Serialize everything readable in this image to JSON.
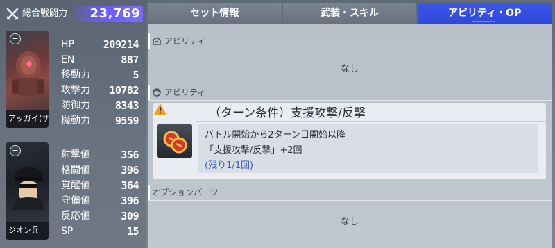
{
  "combat_power": {
    "label": "総合戦闘力",
    "value": "23,769",
    "icon": "crossed-swords-icon"
  },
  "mobile_suit": {
    "name": "アッガイ(サン",
    "stats": [
      {
        "label": "HP",
        "value": "209214"
      },
      {
        "label": "EN",
        "value": "887"
      },
      {
        "label": "移動力",
        "value": "5"
      },
      {
        "label": "攻撃力",
        "value": "10782"
      },
      {
        "label": "防御力",
        "value": "8343"
      },
      {
        "label": "機動力",
        "value": "9559"
      }
    ]
  },
  "pilot": {
    "name": "ジオン兵",
    "stats": [
      {
        "label": "射撃値",
        "value": "356"
      },
      {
        "label": "格闘値",
        "value": "396"
      },
      {
        "label": "覚醒値",
        "value": "364"
      },
      {
        "label": "守備値",
        "value": "396"
      },
      {
        "label": "反応値",
        "value": "309"
      },
      {
        "label": "SP",
        "value": "15"
      }
    ]
  },
  "tabs": [
    {
      "label": "セット情報",
      "active": false
    },
    {
      "label": "武装・スキル",
      "active": false
    },
    {
      "label": "アビリティ・OP",
      "active": true
    }
  ],
  "sections": {
    "ms_ability": {
      "heading": "アビリティ",
      "empty_text": "なし",
      "icon": "ms-head-icon"
    },
    "pilot_ability": {
      "heading": "アビリティ",
      "icon": "pilot-head-icon"
    },
    "option_parts": {
      "heading": "オプションパーツ",
      "empty_text": "なし"
    }
  },
  "skill": {
    "title": "（ターン条件）支援攻撃/反撃",
    "line1": "バトル開始から2ターン目開始以降",
    "line2": "「支援攻撃/反撃」+2回",
    "line3": "(残り1/1回)",
    "warning_color": "#f0a020"
  }
}
